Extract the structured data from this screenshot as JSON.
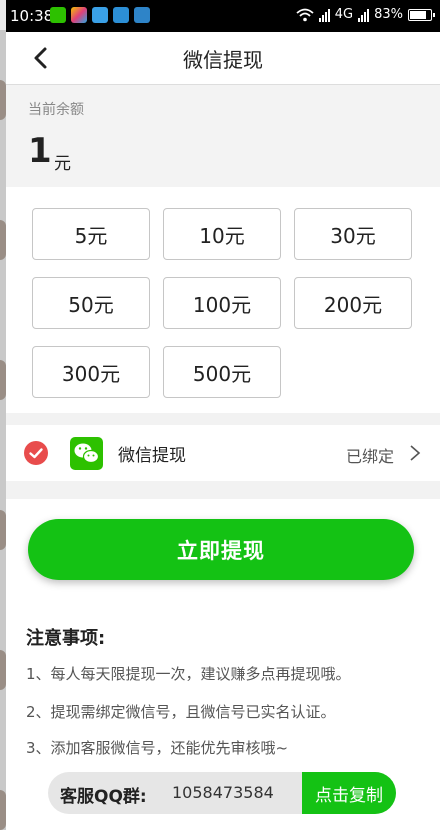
{
  "status_bar": {
    "time": "10:38",
    "network": "4G",
    "battery": "83%"
  },
  "nav": {
    "title": "微信提现"
  },
  "balance": {
    "label": "当前余额",
    "value": "1",
    "unit": "元"
  },
  "amount_options": [
    "5元",
    "10元",
    "30元",
    "50元",
    "100元",
    "200元",
    "300元",
    "500元"
  ],
  "payment_method": {
    "label": "微信提现",
    "status": "已绑定"
  },
  "withdraw_button": {
    "label": "立即提现"
  },
  "notes": {
    "title": "注意事项:",
    "items": [
      "1、每人每天限提现一次，建议赚多点再提现哦。",
      "2、提现需绑定微信号，且微信号已实名认证。",
      "3、添加客服微信号，还能优先审核哦~"
    ]
  },
  "support": {
    "label": "客服QQ群:",
    "number": "1058473584",
    "copy_label": "点击复制"
  },
  "colors": {
    "accent_green": "#14c214",
    "check_red": "#e84c4c",
    "wechat_green": "#2dc100"
  }
}
